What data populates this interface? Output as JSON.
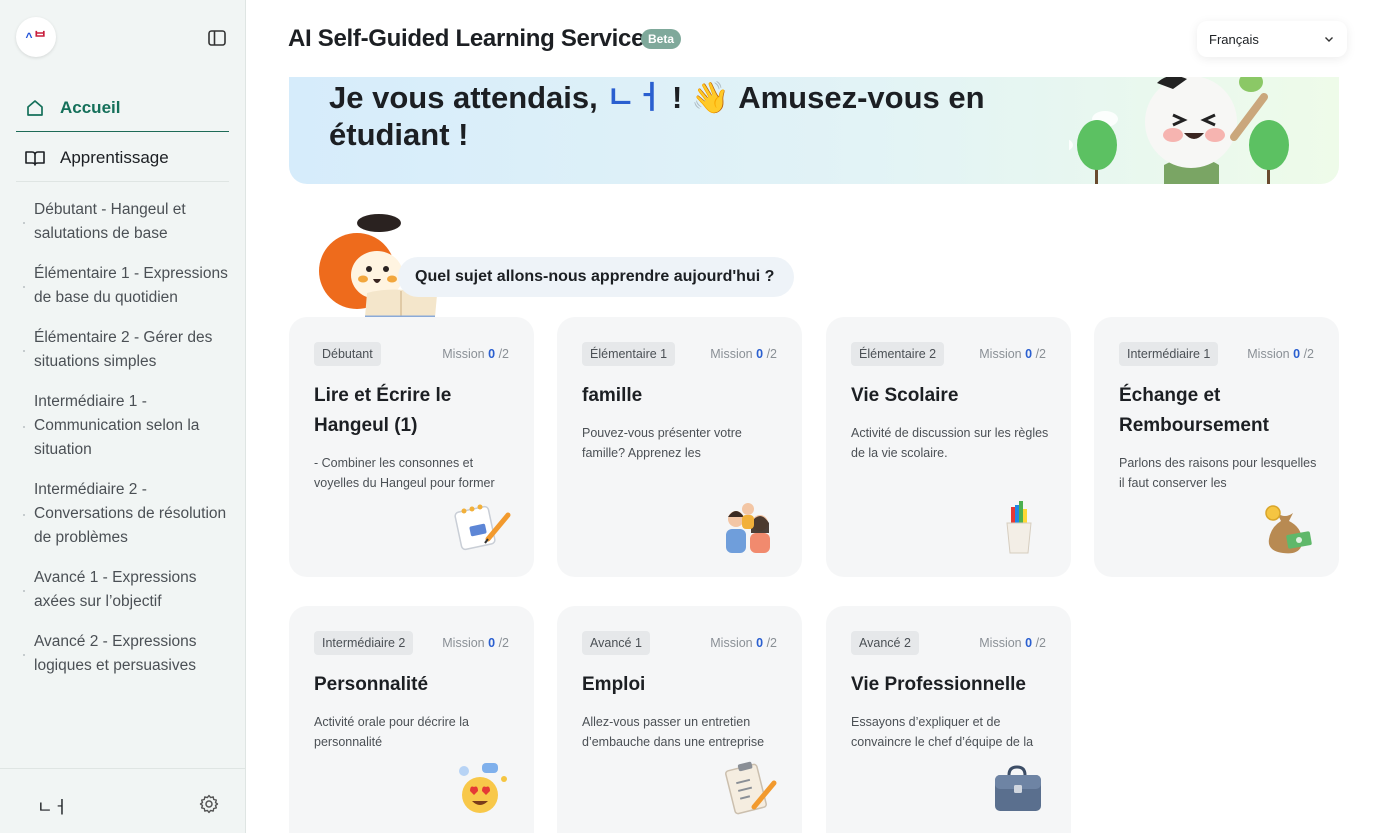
{
  "sidebar": {
    "user_name": "ㄴㅓ",
    "nav": {
      "home": "Accueil",
      "learning": "Apprentissage"
    },
    "levels": [
      "Débutant - Hangeul et salutations de base",
      "Élémentaire 1 - Expressions de base du quotidien",
      "Élémentaire 2 - Gérer des situations simples",
      "Intermédiaire 1 - Communication selon la situation",
      "Intermédiaire 2 - Conversations de résolution de problèmes",
      "Avancé 1 - Expressions axées sur l’objectif",
      "Avancé 2 - Expressions logiques et persuasives"
    ]
  },
  "header": {
    "title": "AI Self-Guided Learning Service",
    "badge": "Beta",
    "language": "Français"
  },
  "banner": {
    "prefix": "Je vous attendais, ",
    "name": "ㄴㅓ",
    "suffix": " ! 👋 Amusez-vous en étudiant !"
  },
  "greeting": "Quel sujet allons-nous apprendre aujourd'hui ?",
  "cards": [
    {
      "level": "Débutant",
      "mission_label": "Mission",
      "done": "0",
      "total": "/2",
      "title": "Lire et Écrire le Hangeul (1)",
      "desc": "- Combiner les consonnes et voyelles du Hangeul pour former",
      "icon": "notebook-icon"
    },
    {
      "level": "Élémentaire 1",
      "mission_label": "Mission",
      "done": "0",
      "total": "/2",
      "title": "famille",
      "desc": "Pouvez-vous présenter votre famille? Apprenez les",
      "icon": "family-icon"
    },
    {
      "level": "Élémentaire 2",
      "mission_label": "Mission",
      "done": "0",
      "total": "/2",
      "title": "Vie Scolaire",
      "desc": "Activité de discussion sur les règles de la vie scolaire.",
      "icon": "pencil-cup-icon"
    },
    {
      "level": "Intermédiaire 1",
      "mission_label": "Mission",
      "done": "0",
      "total": "/2",
      "title": "Échange et Remboursement",
      "desc": "Parlons des raisons pour lesquelles il faut conserver les",
      "icon": "money-bag-icon"
    },
    {
      "level": "Intermédiaire 2",
      "mission_label": "Mission",
      "done": "0",
      "total": "/2",
      "title": "Personnalité",
      "desc": "Activité orale pour décrire la personnalité",
      "icon": "heart-eyes-icon"
    },
    {
      "level": "Avancé 1",
      "mission_label": "Mission",
      "done": "0",
      "total": "/2",
      "title": "Emploi",
      "desc": "Allez-vous passer un entretien d’embauche dans une entreprise",
      "icon": "clipboard-icon"
    },
    {
      "level": "Avancé 2",
      "mission_label": "Mission",
      "done": "0",
      "total": "/2",
      "title": "Vie Professionnelle",
      "desc": "Essayons d’expliquer et de convaincre le chef d’équipe de la",
      "icon": "briefcase-icon"
    }
  ]
}
